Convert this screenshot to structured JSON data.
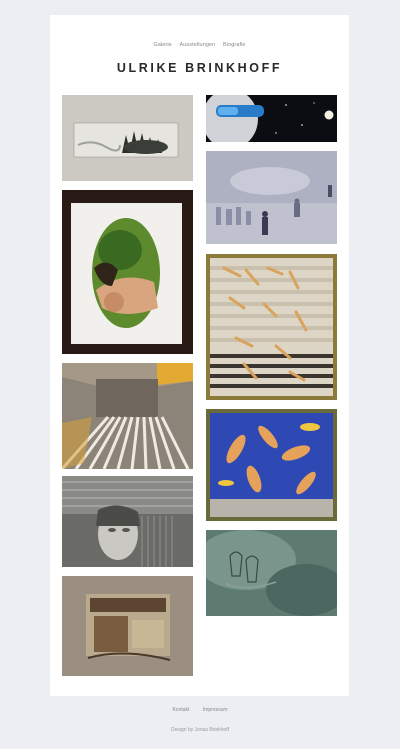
{
  "nav": {
    "items": [
      {
        "label": "Galerie"
      },
      {
        "label": "Ausstellungen"
      },
      {
        "label": "Biografie"
      }
    ]
  },
  "site": {
    "title": "ULRIKE BRINKHOFF"
  },
  "gallery": {
    "items": [
      {
        "icon": "artwork-dark-plant-print"
      },
      {
        "icon": "artwork-face-sunglasses"
      },
      {
        "icon": "artwork-foggy-figures"
      },
      {
        "icon": "artwork-oval-figure"
      },
      {
        "icon": "artwork-falling-figures-frame"
      },
      {
        "icon": "artwork-corridor-stripes"
      },
      {
        "icon": "artwork-blue-dancers-frame"
      },
      {
        "icon": "artwork-grey-face-lines"
      },
      {
        "icon": "artwork-green-abstract"
      },
      {
        "icon": "artwork-brown-collage"
      }
    ]
  },
  "footer": {
    "links": [
      {
        "label": "Kontakt"
      },
      {
        "label": "Impressum"
      }
    ],
    "credit": "Design by Jonas Brinkhoff"
  },
  "colors": {
    "background": "#eceef3",
    "card": "#ffffff",
    "title": "#2a2a2a",
    "link": "#888888"
  }
}
